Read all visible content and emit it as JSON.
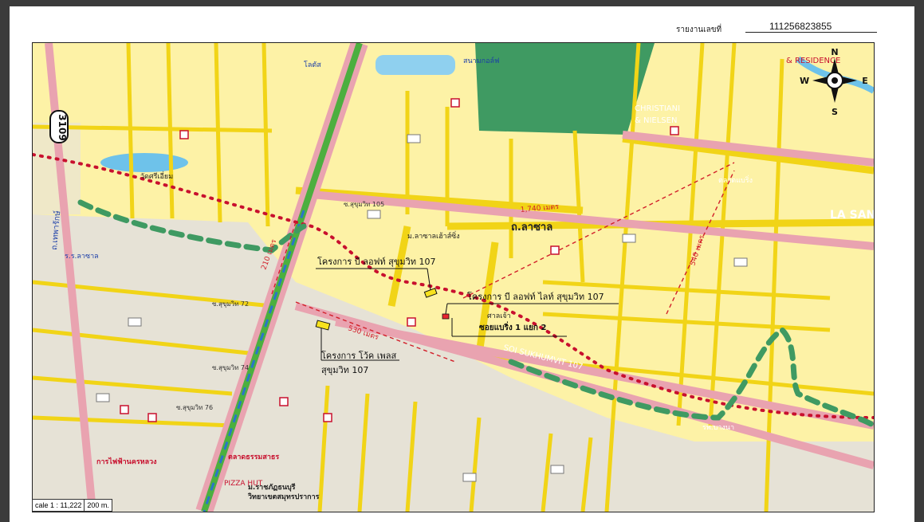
{
  "report": {
    "label": "รายงานเลขที่",
    "number": "111256823855"
  },
  "compass": {
    "n": "N",
    "s": "S",
    "e": "E",
    "w": "W"
  },
  "projects": {
    "p1": "โครงการ บี ลอฟท์ สุขุมวิท 107",
    "p2": "โครงการ บี ลอฟท์ ไลท์ สุขุมวิท 107",
    "p3_line1": "โครงการ โว้ค เพลส",
    "p3_line2": "สุขุมวิท 107"
  },
  "distances": {
    "d1": "1,740 เมตร",
    "d2": "210 เมตร",
    "d3": "530 เมตร",
    "d4": "540 เมตร"
  },
  "road_labels": {
    "route": "3109",
    "la_salle": "ถ.ลาซาล",
    "la_san": "LA SAN",
    "soi_sukhumvit": "SOI SUKHUMVIT 107",
    "sukhumvit_105": "ซ.สุขุมวิท 105",
    "sukhumvit_72": "ซ.สุขุมวิท 72",
    "sukhumvit_74": "ซ.สุขุมวิท 74",
    "sukhumvit_76": "ซ.สุขุมวิท 76",
    "soi_bearing_1": "ซอยแบริ่ง 1 แยก 2",
    "thepharak": "ถ.เทพารักษ์",
    "christiani": "CHRISTIANI",
    "nielsen": "& NIELSEN",
    "residence": "& RESIDENCE"
  },
  "places": {
    "lasalle_school": "ร.ร.ลาซาล",
    "navy_golf": "สนามกอล์ฟ",
    "tesco": "โลตัส",
    "lasalle_village": "ม.ลาซาลเฮ้าส์ซิ่ง",
    "market": "ตลาดธรรมสาธร",
    "bearing_market": "ตลาดแบริ่ง",
    "rajabhat": "ม.ราชภัฏธนบุรี",
    "rajabhat2": "วิทยาเขตสมุทรปราการ",
    "pizza": "PIZZA HUT",
    "electric": "การไฟฟ้านครหลวง",
    "hospital": "รพ.บางนา",
    "temple": "วัดศรีเอี่ยม",
    "shrine": "ศาลเจ้า"
  },
  "scale": {
    "ratio": "cale 1 : 11,222",
    "distance": "200 m."
  },
  "colors": {
    "map_bg": "#fdf2a6",
    "urban": "#e8e3d8",
    "road_yellow": "#f1d417",
    "road_pink": "#e9a3b0",
    "highway_green": "#4caf3f",
    "park": "#3f9a62",
    "water": "#6ec2ea",
    "red_route": "#c8102e"
  }
}
